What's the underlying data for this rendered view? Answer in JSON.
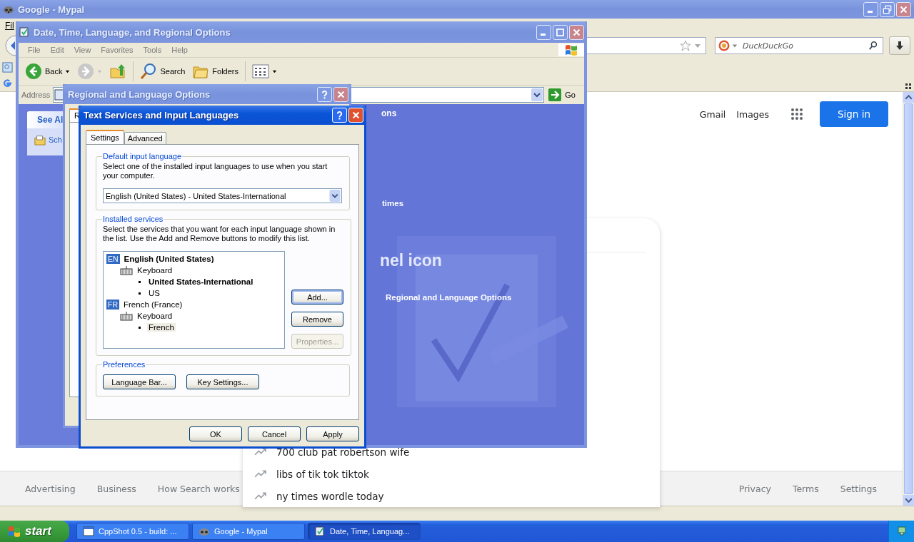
{
  "browser": {
    "title": "Google - Mypal",
    "menu": [
      "Fil"
    ],
    "search_placeholder": "DuckDuckGo",
    "header_links": [
      "Gmail",
      "Images"
    ],
    "sign_in": "Sign in",
    "suggestions": [
      "700 club pat robertson wife",
      "libs of tik tok tiktok",
      "ny times wordle today"
    ],
    "footer_left": [
      "Advertising",
      "Business",
      "How Search works"
    ],
    "footer_right": [
      "Privacy",
      "Terms",
      "Settings"
    ]
  },
  "explorer": {
    "title": "Date, Time, Language, and Regional Options",
    "menu": [
      "File",
      "Edit",
      "View",
      "Favorites",
      "Tools",
      "Help"
    ],
    "toolbar": [
      {
        "kind": "back",
        "label": "Back"
      },
      {
        "kind": "forward"
      },
      {
        "kind": "up"
      },
      {
        "kind": "search",
        "label": "Search"
      },
      {
        "kind": "folders",
        "label": "Folders"
      },
      {
        "kind": "views"
      }
    ],
    "address_label": "Address",
    "go": "Go",
    "see_also": "See Al",
    "task": "Sch",
    "section_title": "ons",
    "task_link": "times",
    "pick_heading": "nel icon",
    "pick_link": "Regional and Language Options"
  },
  "regional": {
    "title": "Regional and Language Options",
    "tabs": [
      {
        "label": "R",
        "selected": true
      }
    ]
  },
  "text_services": {
    "title": "Text Services and Input Languages",
    "tabs": [
      {
        "label": "Settings",
        "selected": true
      },
      {
        "label": "Advanced",
        "selected": false
      }
    ],
    "default_group": {
      "title": "Default input language",
      "description": "Select one of the installed input languages to use when you start your computer.",
      "value": "English (United States) - United States-International"
    },
    "services_group": {
      "title": "Installed services",
      "description": "Select the services that you want for each input language shown in the list. Use the Add and Remove buttons to modify this list.",
      "tree": [
        {
          "kind": "language",
          "badge": "EN",
          "label": "English (United States)",
          "default": true,
          "selected": false,
          "children": [
            {
              "kind": "category",
              "label": "Keyboard",
              "default": false,
              "selected": false,
              "children": [
                {
                  "kind": "layout",
                  "label": "United States-International",
                  "default": true,
                  "selected": false
                },
                {
                  "kind": "layout",
                  "label": "US",
                  "default": false,
                  "selected": false
                }
              ]
            }
          ]
        },
        {
          "kind": "language",
          "badge": "FR",
          "label": "French (France)",
          "default": false,
          "selected": false,
          "children": [
            {
              "kind": "category",
              "label": "Keyboard",
              "default": false,
              "selected": false,
              "children": [
                {
                  "kind": "layout",
                  "label": "French",
                  "default": false,
                  "selected": true
                }
              ]
            }
          ]
        }
      ],
      "buttons": [
        {
          "label": "Add...",
          "focused": true,
          "disabled": false
        },
        {
          "label": "Remove",
          "focused": false,
          "disabled": false
        },
        {
          "label": "Properties...",
          "focused": false,
          "disabled": true
        }
      ]
    },
    "preferences_group": {
      "title": "Preferences",
      "buttons": [
        "Language Bar...",
        "Key Settings..."
      ]
    },
    "buttons": [
      "OK",
      "Cancel",
      "Apply"
    ]
  },
  "taskbar": {
    "start": "start",
    "tasks": [
      {
        "kind": "window",
        "label": "CppShot 0.5 - build: ...",
        "selected": false
      },
      {
        "kind": "browser",
        "label": "Google - Mypal",
        "selected": false
      },
      {
        "kind": "folder",
        "label": "Date, Time, Languag...",
        "selected": true
      }
    ]
  }
}
